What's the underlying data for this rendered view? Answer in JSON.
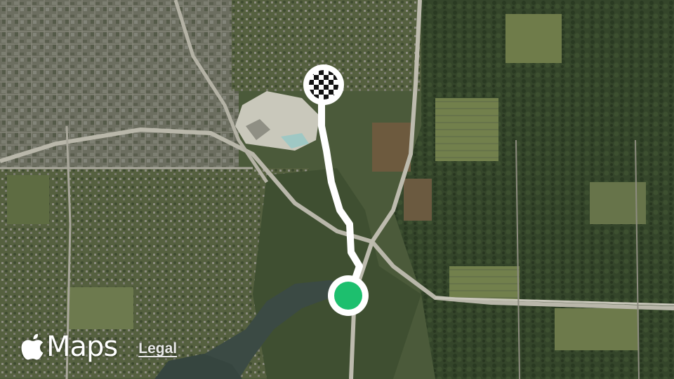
{
  "map": {
    "type": "satellite",
    "colors": {
      "terrain": "#4a5a3c",
      "urban": "#6f7163",
      "forest": "#2f3f25",
      "field": "#7d8a55",
      "water": "#3a4a45",
      "quarry": "#c9c9bd",
      "road": "#c2c0b4",
      "route_line": "#ffffff",
      "start_marker": "#1dbf6e",
      "end_marker": "#111111"
    },
    "start_marker": {
      "icon": "green-dot-icon"
    },
    "end_marker": {
      "icon": "checkered-flag-icon"
    }
  },
  "attribution": {
    "brand_icon": "apple-logo-icon",
    "brand_label": "Maps",
    "legal_label": "Legal"
  }
}
